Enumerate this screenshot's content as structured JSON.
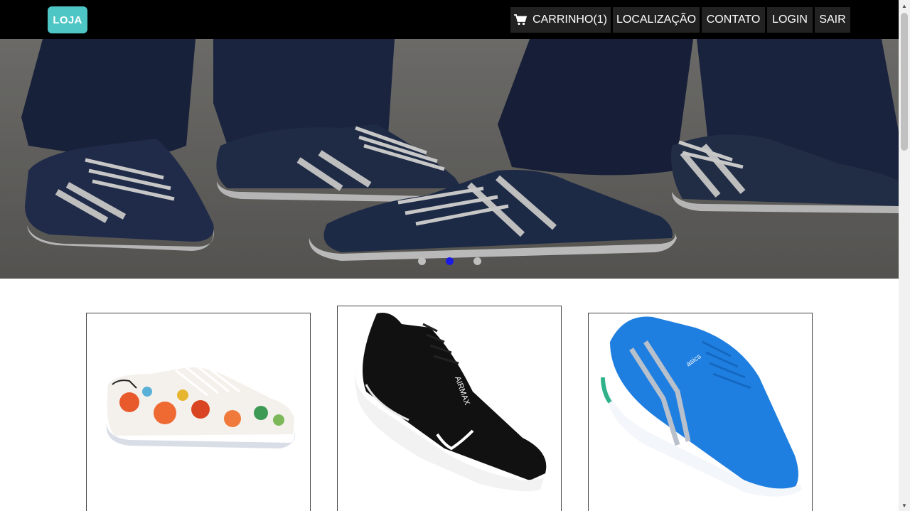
{
  "navbar": {
    "brand": "LOJA",
    "items": [
      {
        "label": "CARRINHO(1)",
        "icon": "shopping-cart-icon"
      },
      {
        "label": "LOCALIZAÇÃO"
      },
      {
        "label": "CONTATO"
      },
      {
        "label": "LOGIN"
      },
      {
        "label": "SAIR"
      }
    ]
  },
  "carousel": {
    "slide_count": 3,
    "active_index": 1
  },
  "colors": {
    "navbar_bg": "#000000",
    "nav_item_bg": "#222222",
    "brand_bg": "#4ec6c6",
    "dot_active": "#1a1ae6",
    "dot_inactive": "#bfbfbf"
  },
  "products": [
    {
      "image": "floral-sneaker-image"
    },
    {
      "image": "black-nike-sneaker-image"
    },
    {
      "image": "blue-asics-running-shoe-image"
    }
  ]
}
